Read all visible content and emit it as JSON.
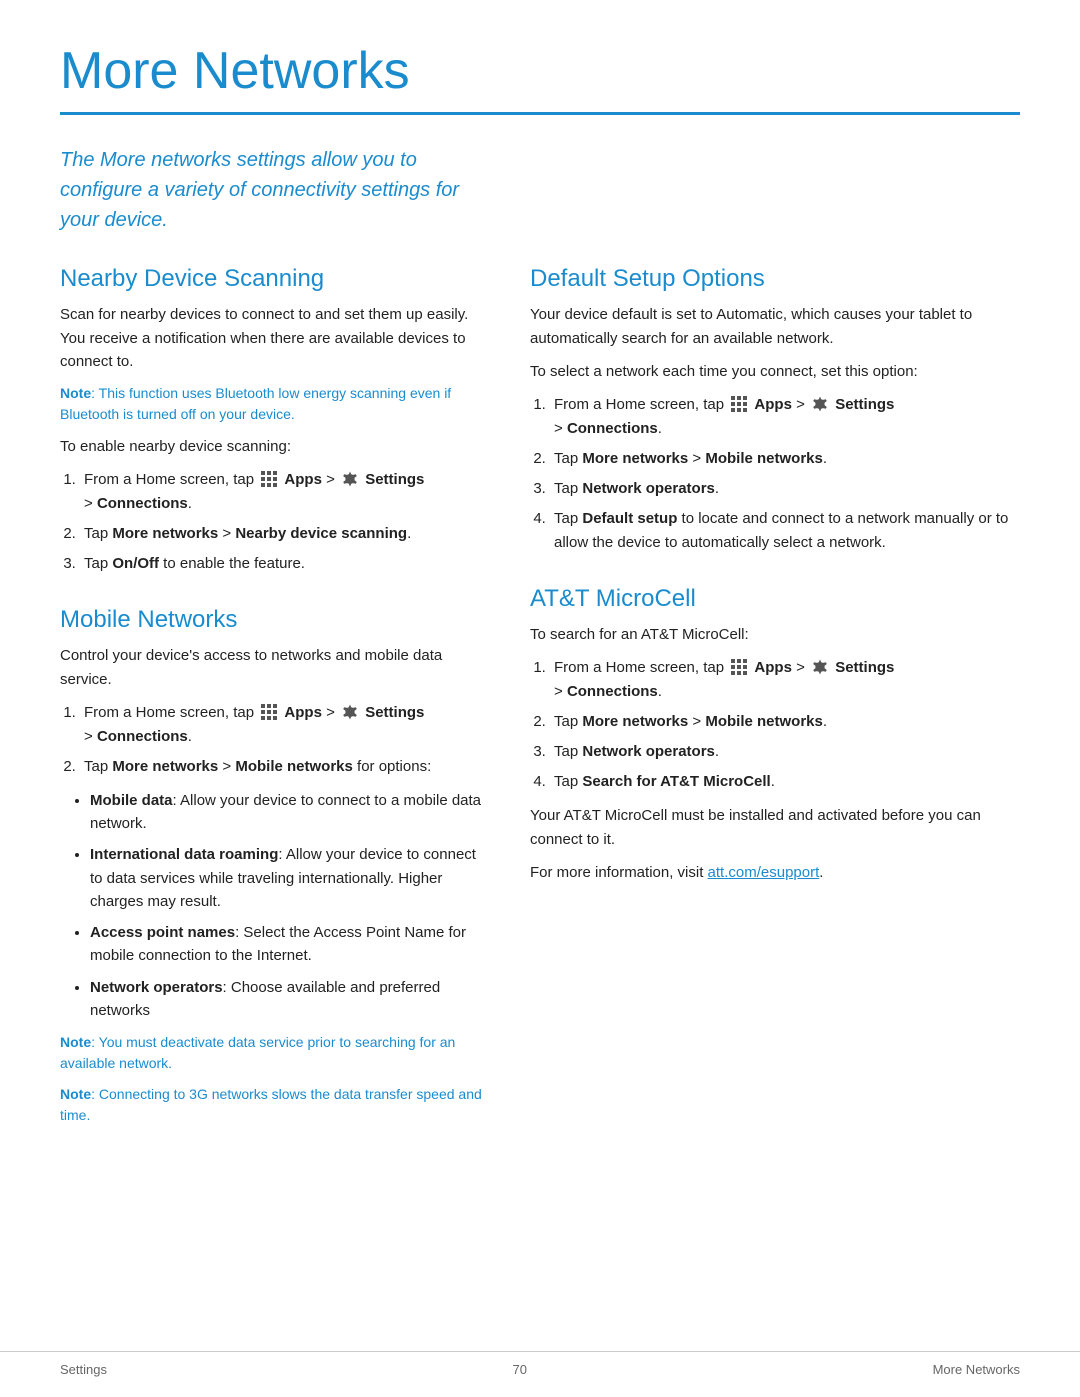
{
  "page": {
    "title": "More Networks",
    "intro": "The More networks settings allow you to configure a variety of connectivity settings for your device.",
    "footer": {
      "left": "Settings",
      "center": "70",
      "right": "More Networks"
    }
  },
  "left_col": {
    "sections": [
      {
        "id": "nearby-device-scanning",
        "title": "Nearby Device Scanning",
        "paragraphs": [
          "Scan for nearby devices to connect to and set them up easily. You receive a notification when there are available devices to connect to."
        ],
        "note": "Note: This function uses Bluetooth low energy scanning even if Bluetooth is turned off on your device.",
        "steps_intro": "To enable nearby device scanning:",
        "steps": [
          {
            "html": "From a Home screen, tap [APPS] Apps > [SETTINGS] Settings > Connections."
          },
          {
            "html": "Tap More networks > Nearby device scanning."
          },
          {
            "html": "Tap On/Off to enable the feature."
          }
        ]
      },
      {
        "id": "mobile-networks",
        "title": "Mobile Networks",
        "paragraphs": [
          "Control your device’s access to networks and mobile data service."
        ],
        "steps_intro": null,
        "steps": [
          {
            "html": "From a Home screen, tap [APPS] Apps > [SETTINGS] Settings > Connections."
          },
          {
            "html": "Tap More networks > Mobile networks for options:"
          }
        ],
        "bullet_items": [
          {
            "label": "Mobile data",
            "text": ": Allow your device to connect to a mobile data network."
          },
          {
            "label": "International data roaming",
            "text": ": Allow your device to connect to data services while traveling internationally. Higher charges may result."
          },
          {
            "label": "Access point names",
            "text": ": Select the Access Point Name for mobile connection to the Internet."
          },
          {
            "label": "Network operators",
            "text": ": Choose available and preferred networks"
          }
        ],
        "bullet_split": 2,
        "notes": [
          "Note: You must deactivate data service prior to searching for an available network.",
          "Note: Connecting to 3G networks slows the data transfer speed and time."
        ]
      }
    ]
  },
  "right_col": {
    "sections": [
      {
        "id": "default-setup-options",
        "title": "Default Setup Options",
        "paragraphs": [
          "Your device default is set to Automatic, which causes your tablet to automatically search for an available network.",
          "To select a network each time you connect, set this option:"
        ],
        "steps": [
          {
            "html": "From a Home screen, tap [APPS] Apps > [SETTINGS] Settings > Connections."
          },
          {
            "html": "Tap More networks > Mobile networks."
          },
          {
            "html": "Tap Network operators."
          },
          {
            "html": "Tap Default setup to locate and connect to a network manually or to allow the device to automatically select a network."
          }
        ]
      },
      {
        "id": "att-microcell",
        "title": "AT&T MicroCell",
        "intro": "To search for an AT&T MicroCell:",
        "steps": [
          {
            "html": "From a Home screen, tap [APPS] Apps > [SETTINGS] Settings > Connections."
          },
          {
            "html": "Tap More networks > Mobile networks."
          },
          {
            "html": "Tap Network operators."
          },
          {
            "html": "Tap Search for AT&T MicroCell."
          }
        ],
        "paragraphs_after": [
          "Your AT&T MicroCell must be installed and activated before you can connect to it.",
          "For more information, visit [LINK]att.com/esupport[/LINK]."
        ]
      }
    ]
  }
}
